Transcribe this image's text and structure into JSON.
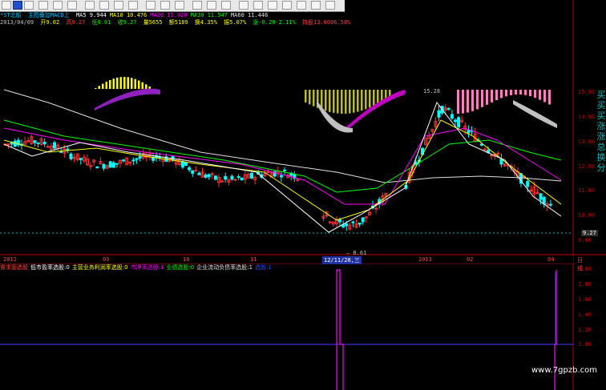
{
  "toolbar": {
    "title": "*ST北船",
    "subtitle": "主图叠加MACD上"
  },
  "ma_line": [
    {
      "label": "MA5",
      "value": "9.944",
      "color": "#ffffff"
    },
    {
      "label": "MA10",
      "value": "10.476",
      "color": "#ffff00"
    },
    {
      "label": "MA20",
      "value": "11.020",
      "color": "#ff00ff"
    },
    {
      "label": "MA30",
      "value": "11.547",
      "color": "#00ff00"
    },
    {
      "label": "MA60",
      "value": "11.446",
      "color": "#e0e0e0"
    },
    {
      "label": "",
      "value": "",
      "color": "#ff4040"
    }
  ],
  "info_line": {
    "date": "2013/04/09",
    "open": "开9.02",
    "high": "高9.27",
    "low": "低9.01",
    "close": "收9.27",
    "volume": "量5655",
    "turn": "额5189",
    "rate": "换4.35%",
    "amp": "振5.07%",
    "chg": "涨-0.20-2.11%",
    "close2": "持股13.0006.58%"
  },
  "price_axis": {
    "ticks": [
      "15.00",
      "14.00",
      "13.00",
      "12.00",
      "11.00",
      "10.00",
      "9.00"
    ],
    "current": "9.27",
    "high_mark": "15.28",
    "low_mark": "8.61"
  },
  "side_labels": [
    "买",
    "买",
    "买",
    "涨",
    "涨",
    "总",
    "换",
    "分"
  ],
  "time_axis": [
    "2012",
    "09",
    "10",
    "11",
    "12/11/28,三",
    "2013",
    "02",
    "04",
    "日线"
  ],
  "indicator": {
    "labels": [
      {
        "text": "需求面选股",
        "color": "#ff4040"
      },
      {
        "text": "低市盈率选股:0",
        "color": "#ffffff"
      },
      {
        "text": "主营业务利润率选股:0",
        "color": "#ffff00"
      },
      {
        "text": "市净率选股:1",
        "color": "#ff00ff"
      },
      {
        "text": "业绩选股:0",
        "color": "#00ff00"
      },
      {
        "text": "企业流动负债率选股:1",
        "color": "#e0e0e0"
      },
      {
        "text": "选股:1",
        "color": "#2050ff"
      }
    ],
    "axis": [
      "2.00",
      "1.80",
      "1.60",
      "1.40",
      "1.20",
      "1.00"
    ]
  },
  "watermark": "www.7gpzb.com",
  "colors": {
    "up": "#ff3030",
    "down": "#00ffff",
    "grid": "#6060c0"
  }
}
